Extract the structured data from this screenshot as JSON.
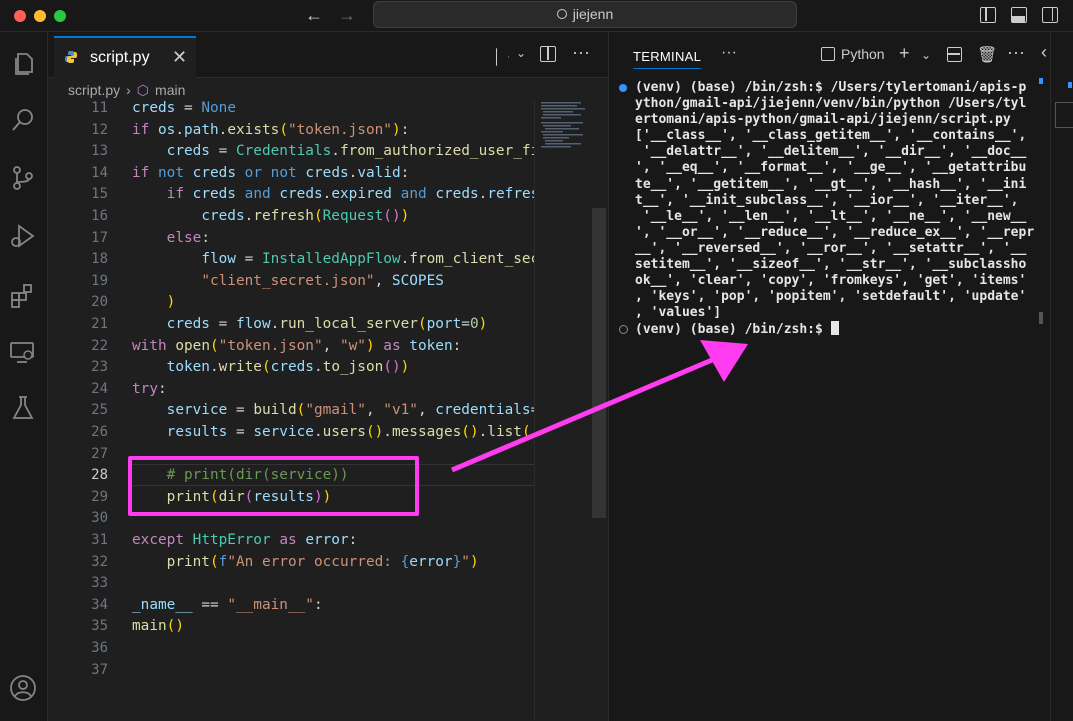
{
  "window": {
    "search_text": "jiejenn"
  },
  "editor": {
    "tab_label": "script.py",
    "breadcrumb": {
      "file": "script.py",
      "symbol": "main"
    },
    "line_numbers": [
      "11",
      "12",
      "13",
      "14",
      "15",
      "16",
      "17",
      "18",
      "19",
      "20",
      "21",
      "22",
      "23",
      "24",
      "25",
      "26",
      "27",
      "28",
      "29",
      "30",
      "31",
      "32",
      "33",
      "34",
      "35",
      "36",
      "37"
    ],
    "active_line": "28"
  },
  "terminal": {
    "tab_label": "TERMINAL",
    "shell_label": "Python",
    "lines": [
      "(venv) (base) /bin/zsh:$ /Users/tylertomani/apis-p",
      "ython/gmail-api/jiejenn/venv/bin/python /Users/tyl",
      "ertomani/apis-python/gmail-api/jiejenn/script.py",
      "['__class__', '__class_getitem__', '__contains__',",
      " '__delattr__', '__delitem__', '__dir__', '__doc__",
      "', '__eq__', '__format__', '__ge__', '__getattribu",
      "te__', '__getitem__', '__gt__', '__hash__', '__ini",
      "t__', '__init_subclass__', '__ior__', '__iter__',",
      " '__le__', '__len__', '__lt__', '__ne__', '__new__",
      "', '__or__', '__reduce__', '__reduce_ex__', '__repr",
      "__', '__reversed__', '__ror__', '__setattr__', '__",
      "setitem__', '__sizeof__', '__str__', '__subclassho",
      "ok__', 'clear', 'copy', 'fromkeys', 'get', 'items'",
      ", 'keys', 'pop', 'popitem', 'setdefault', 'update'",
      ", 'values']"
    ],
    "prompt": "(venv) (base) /bin/zsh:$ "
  },
  "colors": {
    "highlight": "#ff3cf0",
    "accent": "#0078d4"
  }
}
